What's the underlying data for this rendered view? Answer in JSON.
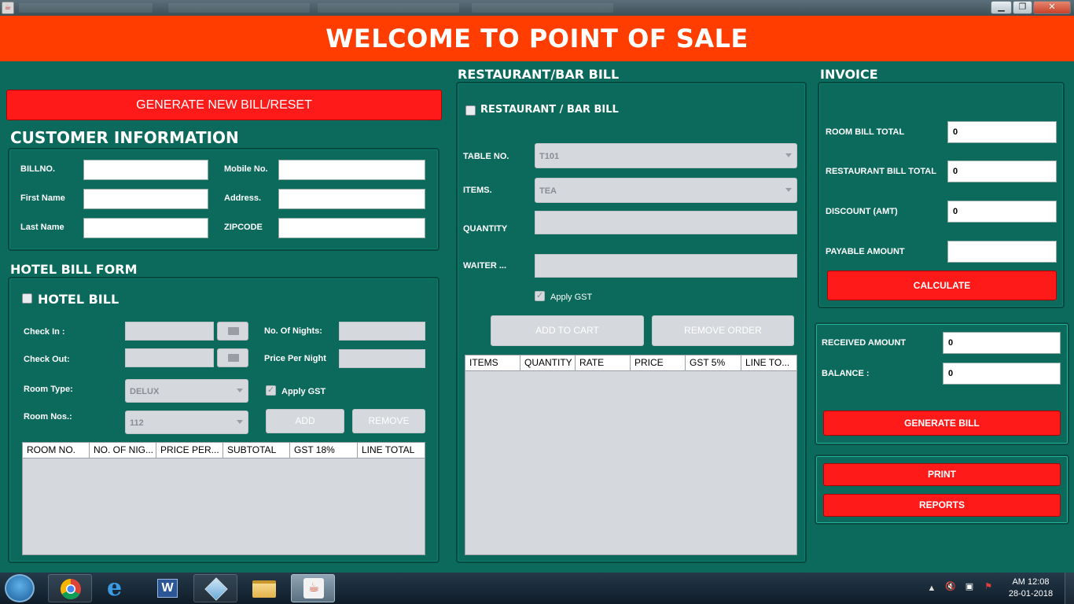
{
  "banner": {
    "title": "WELCOME TO POINT OF SALE"
  },
  "window": {
    "min_label": "▁",
    "max_label": "❐",
    "close_label": "✕",
    "app_icon": "java-icon"
  },
  "left": {
    "reset_button": "GENERATE NEW BILL/RESET",
    "customer": {
      "title": "CUSTOMER INFORMATION",
      "bill_no": "BILLNO.",
      "mobile": "Mobile No.",
      "first_name": "First Name",
      "address": "Address.",
      "last_name": "Last Name",
      "zipcode": "ZIPCODE"
    },
    "hotel": {
      "title": "HOTEL BILL FORM",
      "checkbox_label": "HOTEL BILL",
      "check_in": "Check In :",
      "check_out": "Check Out:",
      "nights": "No. Of Nights:",
      "price_per_night": "Price Per Night",
      "room_type": "Room Type:",
      "room_type_value": "DELUX",
      "room_nos": "Room Nos.:",
      "room_nos_value": "112",
      "apply_gst": "Apply GST",
      "add": "ADD",
      "remove": "REMOVE",
      "columns": [
        "ROOM NO.",
        "NO. OF NIG...",
        "PRICE PER...",
        "SUBTOTAL",
        "GST 18%",
        "LINE TOTAL"
      ]
    }
  },
  "middle": {
    "title": "RESTAURANT/BAR BILL",
    "checkbox_label": "RESTAURANT / BAR BILL",
    "table_no": "TABLE NO.",
    "table_no_value": "T101",
    "items": "ITEMS.",
    "items_value": "TEA",
    "quantity": "QUANTITY",
    "waiter": "WAITER ...",
    "apply_gst": "Apply GST",
    "add_to_cart": "ADD TO CART",
    "remove_order": "REMOVE ORDER",
    "columns": [
      "ITEMS",
      "QUANTITY",
      "RATE",
      "PRICE",
      "GST 5%",
      "LINE TO..."
    ]
  },
  "right": {
    "title": "INVOICE",
    "room_total": "ROOM  BILL TOTAL",
    "room_total_value": "0",
    "restaurant_total": "RESTAURANT BILL TOTAL",
    "restaurant_total_value": "0",
    "discount": "DISCOUNT (AMT)",
    "discount_value": "0",
    "payable": "PAYABLE AMOUNT",
    "payable_value": "",
    "calculate": "CALCULATE",
    "received": "RECEIVED AMOUNT",
    "received_value": "0",
    "balance": "BALANCE :",
    "balance_value": "0",
    "generate_bill": "GENERATE BILL",
    "print": "PRINT",
    "reports": "REPORTS"
  },
  "taskbar": {
    "apps": [
      "chrome-icon",
      "internet-explorer-icon",
      "word-icon",
      "virtualbox-icon",
      "file-explorer-icon",
      "java-icon"
    ],
    "time": "AM 12:08",
    "date": "28-01-2018"
  },
  "colors": {
    "banner": "#ff3d00",
    "background": "#0b6a5c",
    "button_red": "#ff1a1a"
  }
}
